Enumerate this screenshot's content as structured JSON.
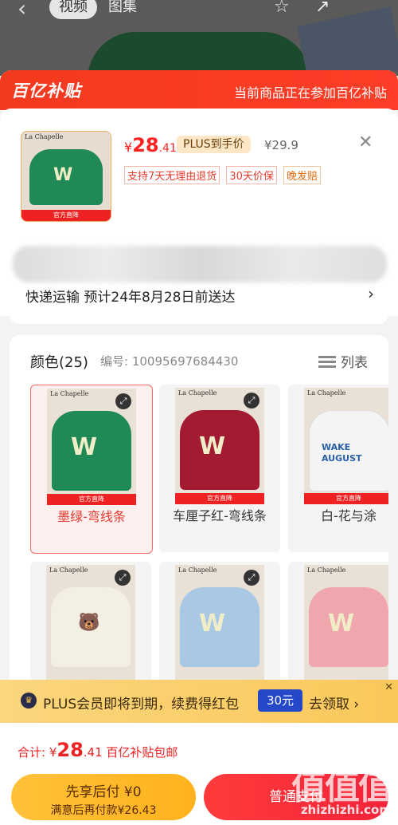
{
  "nav": {
    "back_icon": "chevron-left-icon",
    "tab_video": "视频",
    "tab_pics": "图集"
  },
  "banner": {
    "logo": "百亿补贴",
    "note": "当前商品正在参加百亿补贴"
  },
  "product": {
    "thumb_brand": "La Chapelle",
    "thumb_badge": "官方直降",
    "currency": "¥",
    "price_int": "28",
    "price_dec": ".41",
    "plus_tag": "PLUS到手价",
    "orig_price": "¥29.9",
    "services": [
      "支持7天无理由退货",
      "30天价保",
      "晚发赔"
    ]
  },
  "shipping": {
    "text": "快递运输  预计24年8月28日前送达"
  },
  "colors": {
    "title": "颜色(25)",
    "code": "编号: 10095697684430",
    "list_label": "列表",
    "items": [
      {
        "label": "墨绿-弯线条",
        "shirt": "#1f8a55",
        "selected": true
      },
      {
        "label": "车厘子红-弯线条",
        "shirt": "#a31b33",
        "selected": false
      },
      {
        "label": "白-花与涂",
        "shirt": "#f4f4f4",
        "selected": false
      },
      {
        "label": "",
        "shirt": "#f3efe2",
        "selected": false
      },
      {
        "label": "",
        "shirt": "#a9c8e4",
        "selected": false
      },
      {
        "label": "",
        "shirt": "#f0a6ad",
        "selected": false
      }
    ],
    "tile_badge": "官方直降",
    "wake_text": "WAKE AUGUST"
  },
  "plus_bar": {
    "text": "PLUS会员即将到期，续费得红包",
    "coupon": "30元",
    "cta": "去领取 ›"
  },
  "footer": {
    "total_prefix": "合计: ¥",
    "total_int": "28",
    "total_dec": ".41",
    "total_suffix": "百亿补贴包邮",
    "pay_later_l1": "先享后付 ¥0",
    "pay_later_l2": "满意后再付款¥26.43",
    "normal_btn": "普通支付"
  },
  "watermark": {
    "logo": "值值值",
    "url": "zhizhizhi.com"
  }
}
